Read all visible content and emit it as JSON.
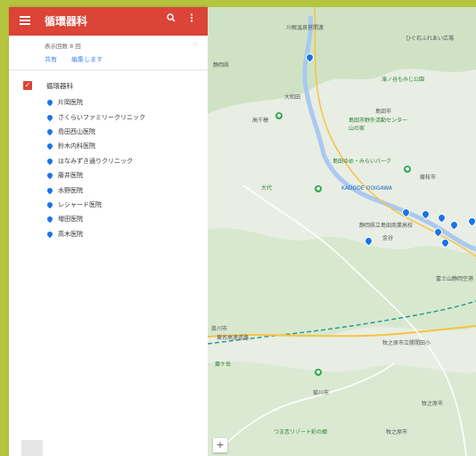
{
  "header": {
    "title": "循環器科"
  },
  "meta": {
    "view_count": "表示回数 8 回",
    "share_label": "共有",
    "edit_label": "編集します"
  },
  "layer": {
    "name": "循環器科"
  },
  "places": [
    "片岡医院",
    "さくらいファミリークリニック",
    "島田西山医院",
    "鈴木内科医院",
    "はなみずき通りクリニック",
    "藤井医院",
    "水野医院",
    "レシャード医院",
    "増田医院",
    "高木医院"
  ],
  "map": {
    "labels": [
      "静岡県",
      "川根温泉笹間渡",
      "大和田",
      "高千穂",
      "ひぐ石ふれあい広場",
      "滝ノ谷もみじ公園",
      "島田市",
      "島田市野外活動センター山の家",
      "島田ゆめ・みらいパーク",
      "KADODE OOIGAWA",
      "静岡県立島田商業高校",
      "藤枝市",
      "東名高速道路",
      "富士山静岡空港",
      "牧之原市立勝間田小",
      "菊川市",
      "掛川市",
      "牧之原市",
      "粟ケ岳",
      "牧之原市",
      "つま恋リゾート彩の郷",
      "金谷",
      "大代"
    ],
    "zoom_in": "+"
  },
  "colors": {
    "header": "#db4437",
    "pin": "#1a73e8",
    "link": "#4285f4"
  }
}
